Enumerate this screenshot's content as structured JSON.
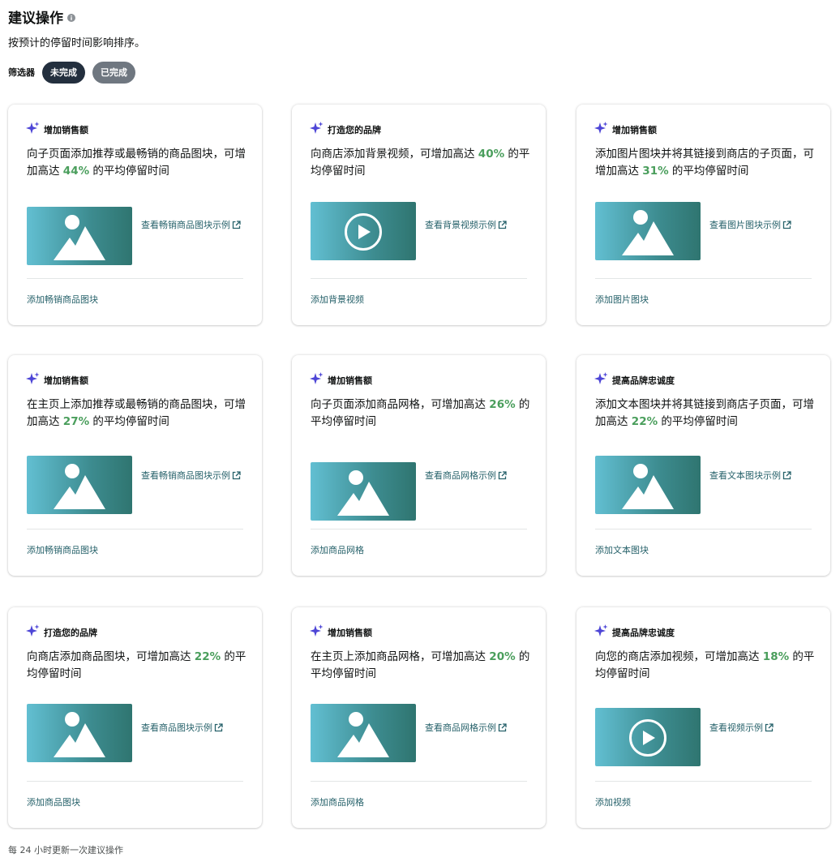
{
  "header": {
    "title": "建议操作",
    "subtitle": "按预计的停留时间影响排序。"
  },
  "filter": {
    "label": "筛选器",
    "options": [
      "未完成",
      "已完成"
    ]
  },
  "cards": [
    {
      "category": "增加销售额",
      "desc_before": "向子页面添加推荐或最畅销的商品图块，可增加高达 ",
      "percent": "44%",
      "desc_after": " 的平均停留时间",
      "thumb": "image-icon",
      "example": "查看畅销商品图块示例",
      "action": "添加畅销商品图块"
    },
    {
      "category": "打造您的品牌",
      "desc_before": "向商店添加背景视频，可增加高达 ",
      "percent": "40%",
      "desc_after": " 的平均停留时间",
      "thumb": "play-icon",
      "example": "查看背景视频示例",
      "action": "添加背景视频"
    },
    {
      "category": "增加销售额",
      "desc_before": "添加图片图块并将其链接到商店的子页面，可增加高达 ",
      "percent": "31%",
      "desc_after": " 的平均停留时间",
      "thumb": "image-icon",
      "example": "查看图片图块示例",
      "action": "添加图片图块"
    },
    {
      "category": "增加销售额",
      "desc_before": "在主页上添加推荐或最畅销的商品图块，可增加高达 ",
      "percent": "27%",
      "desc_after": " 的平均停留时间",
      "thumb": "image-icon",
      "example": "查看畅销商品图块示例",
      "action": "添加畅销商品图块"
    },
    {
      "category": "增加销售额",
      "desc_before": "向子页面添加商品网格，可增加高达 ",
      "percent": "26%",
      "desc_after": " 的平均停留时间",
      "thumb": "image-icon",
      "example": "查看商品网格示例",
      "action": "添加商品网格"
    },
    {
      "category": "提高品牌忠诚度",
      "desc_before": "添加文本图块并将其链接到商店子页面，可增加高达 ",
      "percent": "22%",
      "desc_after": " 的平均停留时间",
      "thumb": "image-icon",
      "example": "查看文本图块示例",
      "action": "添加文本图块"
    },
    {
      "category": "打造您的品牌",
      "desc_before": "向商店添加商品图块，可增加高达 ",
      "percent": "22%",
      "desc_after": " 的平均停留时间",
      "thumb": "image-icon",
      "example": "查看商品图块示例",
      "action": "添加商品图块"
    },
    {
      "category": "增加销售额",
      "desc_before": "在主页上添加商品网格，可增加高达 ",
      "percent": "20%",
      "desc_after": " 的平均停留时间",
      "thumb": "image-icon",
      "example": "查看商品网格示例",
      "action": "添加商品网格"
    },
    {
      "category": "提高品牌忠诚度",
      "desc_before": "向您的商店添加视频，可增加高达 ",
      "percent": "18%",
      "desc_after": " 的平均停留时间",
      "thumb": "play-icon",
      "example": "查看视频示例",
      "action": "添加视频"
    }
  ],
  "footer": "每 24 小时更新一次建议操作",
  "colors": {
    "accent_green": "#4a9e5c",
    "link_teal": "#26616a",
    "pill_active": "#232f3e",
    "pill_inactive": "#6f7780",
    "sparkle": "#4d45d6"
  }
}
